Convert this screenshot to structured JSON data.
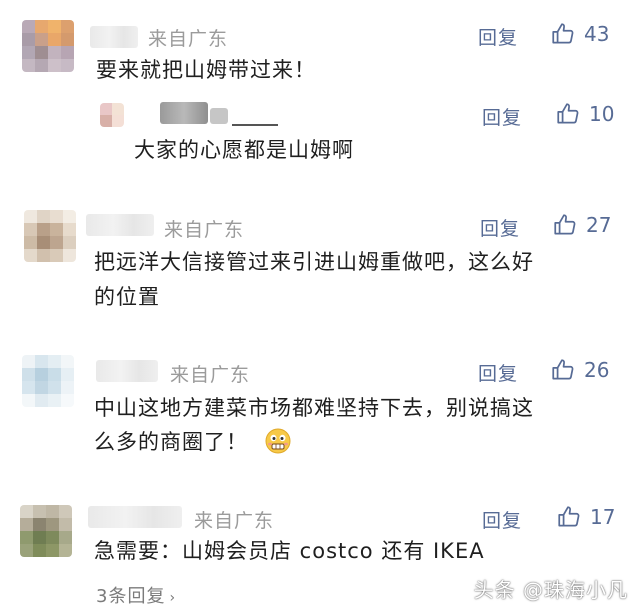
{
  "comments": [
    {
      "location": "来自广东",
      "reply_label": "回复",
      "likes": "43",
      "text": "要来就把山姆带过来！"
    },
    {
      "location": "",
      "reply_label": "回复",
      "likes": "10",
      "text": "大家的心愿都是山姆啊"
    },
    {
      "location": "来自广东",
      "reply_label": "回复",
      "likes": "27",
      "text_line1": "把远洋大信接管过来引进山姆重做吧，这么好",
      "text_line2": "的位置"
    },
    {
      "location": "来自广东",
      "reply_label": "回复",
      "likes": "26",
      "text_line1": "中山这地方建菜市场都难坚持下去，别说搞这",
      "text_line2": "么多的商圈了！"
    },
    {
      "location": "来自广东",
      "reply_label": "回复",
      "likes": "17",
      "text": "急需要：山姆会员店 costco 还有 IKEA",
      "sub_replies": "3条回复"
    }
  ],
  "watermark": "头条 @珠海小凡",
  "colors": {
    "link": "#576b95",
    "meta": "#9b9b9b",
    "text": "#1f1f1f"
  },
  "icons": {
    "like": "thumbs-up-icon",
    "emoji": "grimace-emoji-icon"
  }
}
